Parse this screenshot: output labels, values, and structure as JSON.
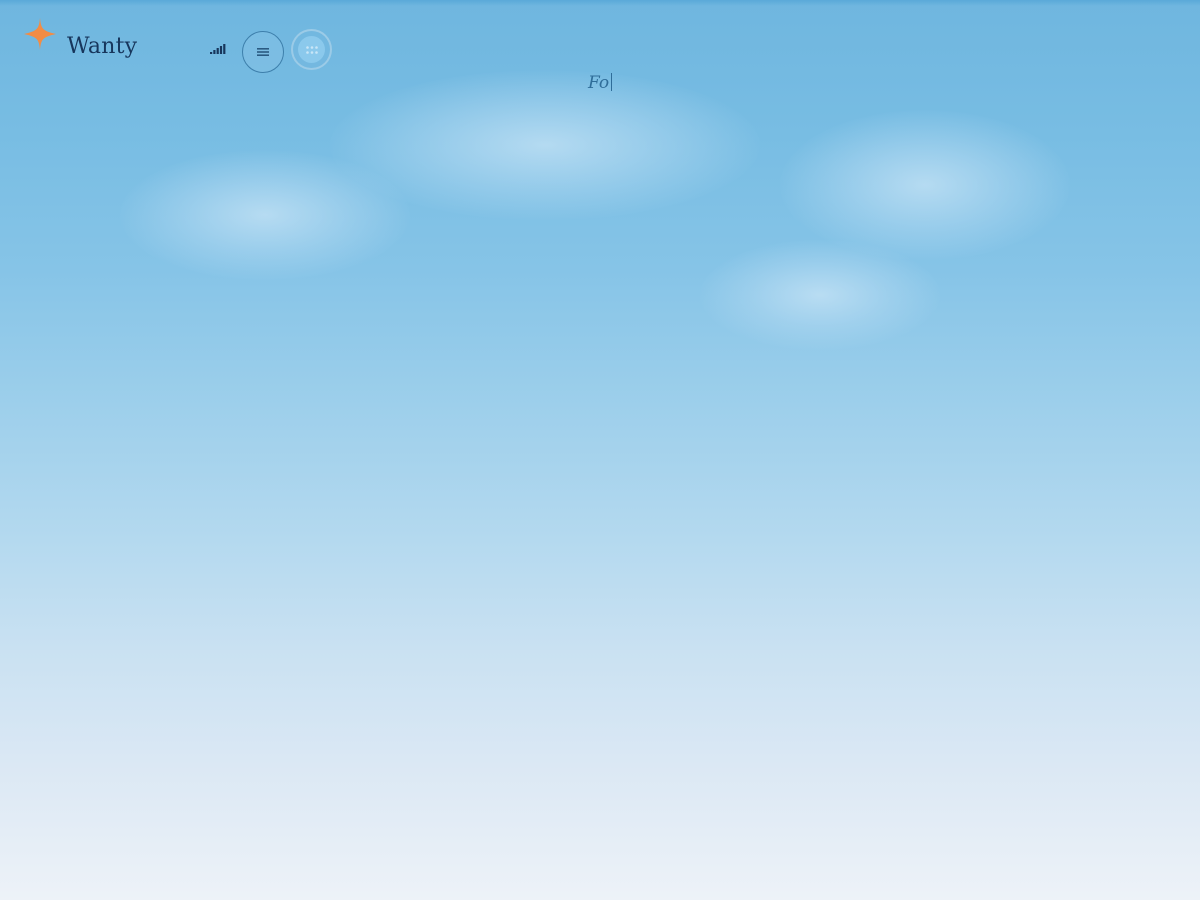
{
  "brand": {
    "name": "Wanty",
    "logo_icon": "four-point-star-icon",
    "logo_color": "#f28c45"
  },
  "header": {
    "signal_icon": "signal-bars-icon",
    "menu_icon": "hamburger-menu-icon",
    "apps_icon": "grid-dots-icon"
  },
  "hero": {
    "typed_text": "Fo"
  },
  "colors": {
    "brand_text": "#17365c",
    "typed_text": "#2f6d99",
    "sky_top": "#6fb6df",
    "sky_bottom": "#edf2f8"
  }
}
